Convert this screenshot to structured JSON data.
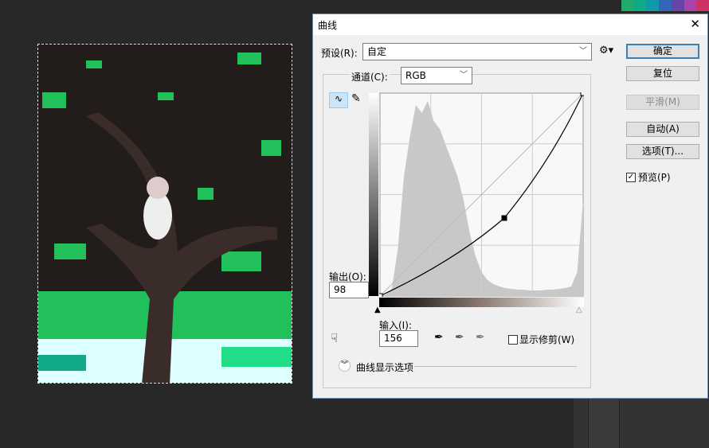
{
  "dialog": {
    "title": "曲线",
    "preset_label": "预设(R):",
    "preset_value": "自定",
    "channel_label": "通道(C):",
    "channel_value": "RGB",
    "output_label": "输出(O):",
    "output_value": "98",
    "input_label": "输入(I):",
    "input_value": "156",
    "show_clipping_label": "显示修剪(W)",
    "show_clipping_checked": false,
    "curve_display_options": "曲线显示选项",
    "buttons": {
      "ok": "确定",
      "reset": "复位",
      "smooth": "平滑(M)",
      "auto": "自动(A)",
      "options": "选项(T)..."
    },
    "preview_label": "预览(P)",
    "preview_checked": true,
    "close_glyph": "✕"
  },
  "chart_data": {
    "type": "line",
    "title": "RGB curve",
    "xlim": [
      0,
      255
    ],
    "ylim": [
      0,
      255
    ],
    "curve_points": [
      [
        0,
        0
      ],
      [
        156,
        98
      ],
      [
        255,
        255
      ]
    ],
    "histogram_levels": [
      0,
      2,
      10,
      60,
      150,
      200,
      240,
      230,
      245,
      220,
      210,
      190,
      170,
      150,
      120,
      80,
      50,
      30,
      20,
      15,
      12,
      10,
      9,
      8,
      8,
      7,
      7,
      7,
      8,
      8,
      9,
      10,
      12,
      30,
      120
    ]
  },
  "colors": {
    "accent": "#3c7fb1",
    "dialog_bg": "#f0f0f0",
    "histogram": "#c8c8c8"
  }
}
